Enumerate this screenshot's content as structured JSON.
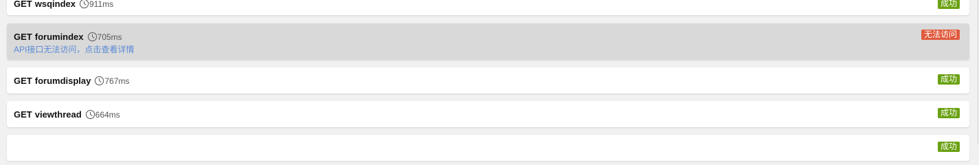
{
  "colors": {
    "success": "#6aa112",
    "error": "#e05a3c",
    "detail_link": "#5a8ad6",
    "row_error_bg": "#d9d9d9"
  },
  "requests": [
    {
      "method": "GET",
      "name": "wsqindex",
      "time": "911ms",
      "status": "成功",
      "status_type": "success",
      "detail": ""
    },
    {
      "method": "GET",
      "name": "forumindex",
      "time": "705ms",
      "status": "无法访问",
      "status_type": "error",
      "detail": "API接口无法访问，点击查看详情"
    },
    {
      "method": "GET",
      "name": "forumdisplay",
      "time": "767ms",
      "status": "成功",
      "status_type": "success",
      "detail": ""
    },
    {
      "method": "GET",
      "name": "viewthread",
      "time": "664ms",
      "status": "成功",
      "status_type": "success",
      "detail": ""
    },
    {
      "method": "",
      "name": "",
      "time": "",
      "status": "成功",
      "status_type": "success",
      "detail": ""
    }
  ]
}
